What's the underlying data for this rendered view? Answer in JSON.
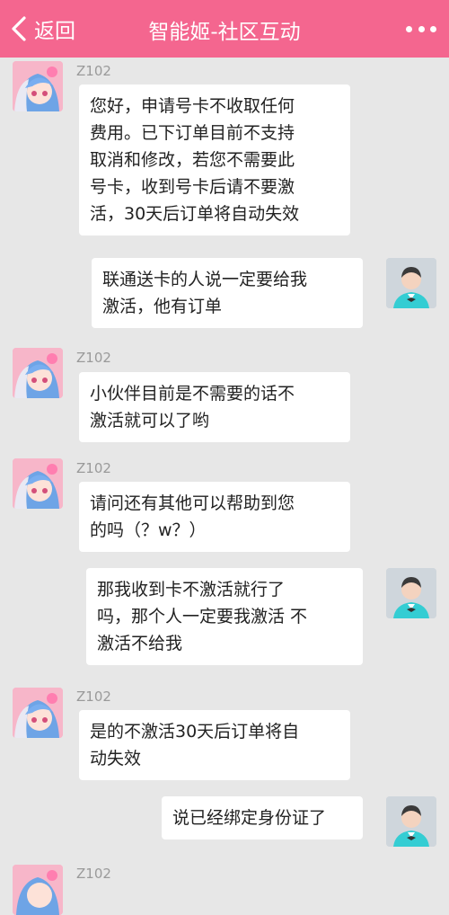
{
  "header": {
    "back_label": "返回",
    "title": "智能姬-社区互动",
    "back_icon": "chevron-left-icon",
    "more_icon": "more-dots-icon"
  },
  "messages": [
    {
      "sender": "Z102",
      "side": "left",
      "text": "您好，申请号卡不收取任何\n费用。已下订单目前不支持\n取消和修改，若您不需要此\n号卡，收到号卡后请不要激\n活，30天后订单将自动失效"
    },
    {
      "sender": "",
      "side": "right",
      "text": "联通送卡的人说一定要给我\n激活，他有订单"
    },
    {
      "sender": "Z102",
      "side": "left",
      "text": "小伙伴目前是不需要的话不\n激活就可以了哟"
    },
    {
      "sender": "Z102",
      "side": "left",
      "text": "请问还有其他可以帮助到您\n的吗（？w？）"
    },
    {
      "sender": "",
      "side": "right",
      "text": "那我收到卡不激活就行了\n吗，那个人一定要我激活 不\n激活不给我"
    },
    {
      "sender": "Z102",
      "side": "left",
      "text": "是的不激活30天后订单将自\n动失效"
    },
    {
      "sender": "",
      "side": "right",
      "text": "说已经绑定身份证了"
    },
    {
      "sender": "Z102",
      "side": "left",
      "text": ""
    }
  ]
}
